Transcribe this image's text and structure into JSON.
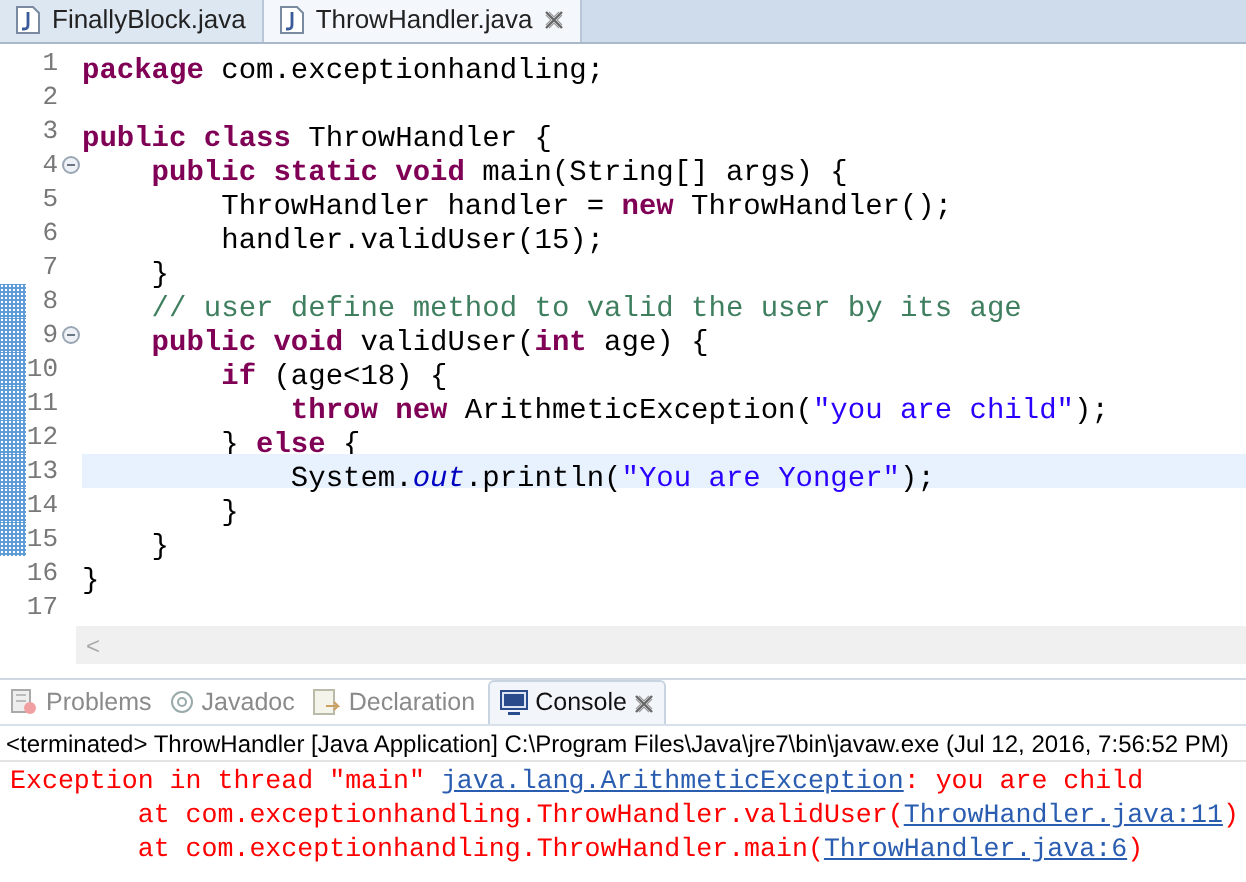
{
  "editor_tabs": [
    {
      "label": "FinallyBlock.java",
      "selected": false,
      "closable": false
    },
    {
      "label": "ThrowHandler.java",
      "selected": true,
      "closable": true
    }
  ],
  "editor": {
    "lines": [
      {
        "number": "1",
        "fold": false,
        "changed": false,
        "current": false,
        "tokens": [
          {
            "kind": "keyword",
            "text": "package"
          },
          {
            "kind": "plain",
            "text": " com.exceptionhandling;"
          }
        ]
      },
      {
        "number": "2",
        "fold": false,
        "changed": false,
        "current": false
      },
      {
        "number": "3",
        "fold": false,
        "changed": false,
        "current": false,
        "tokens": [
          {
            "kind": "keyword",
            "text": "public class"
          },
          {
            "kind": "plain",
            "text": " ThrowHandler {"
          }
        ]
      },
      {
        "number": "4",
        "fold": true,
        "changed": false,
        "current": false,
        "tokens": [
          {
            "kind": "keyword",
            "text": "    public static void"
          },
          {
            "kind": "plain",
            "text": " main(String[] args) {"
          }
        ]
      },
      {
        "number": "5",
        "fold": false,
        "changed": false,
        "current": false,
        "tokens": [
          {
            "kind": "plain",
            "text": "        ThrowHandler handler = "
          },
          {
            "kind": "keyword",
            "text": "new"
          },
          {
            "kind": "plain",
            "text": " ThrowHandler();"
          }
        ]
      },
      {
        "number": "6",
        "fold": false,
        "changed": false,
        "current": false,
        "tokens": [
          {
            "kind": "plain",
            "text": "        handler.validUser(15);"
          }
        ]
      },
      {
        "number": "7",
        "fold": false,
        "changed": false,
        "current": false,
        "tokens": [
          {
            "kind": "plain",
            "text": "    }"
          }
        ]
      },
      {
        "number": "8",
        "fold": false,
        "changed": true,
        "current": false,
        "tokens": [
          {
            "kind": "comment",
            "text": "    // user define method to valid the user by its age"
          }
        ]
      },
      {
        "number": "9",
        "fold": true,
        "changed": true,
        "current": false,
        "tokens": [
          {
            "kind": "keyword",
            "text": "    public void"
          },
          {
            "kind": "plain",
            "text": " validUser("
          },
          {
            "kind": "keyword",
            "text": "int"
          },
          {
            "kind": "plain",
            "text": " age) {"
          }
        ]
      },
      {
        "number": "10",
        "fold": false,
        "changed": true,
        "current": false,
        "tokens": [
          {
            "kind": "keyword",
            "text": "        if"
          },
          {
            "kind": "plain",
            "text": " (age<18) {"
          }
        ]
      },
      {
        "number": "11",
        "fold": false,
        "changed": true,
        "current": false,
        "tokens": [
          {
            "kind": "keyword",
            "text": "            throw new"
          },
          {
            "kind": "plain",
            "text": " ArithmeticException("
          },
          {
            "kind": "string",
            "text": "\"you are child\""
          },
          {
            "kind": "plain",
            "text": ");"
          }
        ]
      },
      {
        "number": "12",
        "fold": false,
        "changed": true,
        "current": false,
        "tokens": [
          {
            "kind": "plain",
            "text": "        } "
          },
          {
            "kind": "keyword",
            "text": "else"
          },
          {
            "kind": "plain",
            "text": " {"
          }
        ]
      },
      {
        "number": "13",
        "fold": false,
        "changed": true,
        "current": true,
        "tokens": [
          {
            "kind": "plain",
            "text": "            System."
          },
          {
            "kind": "field",
            "text": "out"
          },
          {
            "kind": "plain",
            "text": ".println("
          },
          {
            "kind": "string",
            "text": "\"You are Yonger\""
          },
          {
            "kind": "plain",
            "text": ");"
          }
        ]
      },
      {
        "number": "14",
        "fold": false,
        "changed": true,
        "current": false,
        "tokens": [
          {
            "kind": "plain",
            "text": "        }"
          }
        ]
      },
      {
        "number": "15",
        "fold": false,
        "changed": true,
        "current": false,
        "tokens": [
          {
            "kind": "plain",
            "text": "    }"
          }
        ]
      },
      {
        "number": "16",
        "fold": false,
        "changed": false,
        "current": false,
        "tokens": [
          {
            "kind": "plain",
            "text": "}"
          }
        ]
      },
      {
        "number": "17",
        "fold": false,
        "changed": false,
        "current": false
      }
    ],
    "scroll_arrow": "<"
  },
  "panel_tabs": [
    {
      "label": "Problems",
      "kind": "problems",
      "selected": false
    },
    {
      "label": "Javadoc",
      "kind": "javadoc",
      "selected": false
    },
    {
      "label": "Declaration",
      "kind": "declaration",
      "selected": false
    },
    {
      "label": "Console",
      "kind": "console",
      "selected": true
    }
  ],
  "console": {
    "header": "<terminated> ThrowHandler [Java Application] C:\\Program Files\\Java\\jre7\\bin\\javaw.exe (Jul 12, 2016, 7:56:52 PM)",
    "lines": [
      [
        {
          "kind": "error",
          "text": "Exception in thread \"main\" "
        },
        {
          "kind": "link",
          "text": "java.lang.ArithmeticException"
        },
        {
          "kind": "error",
          "text": ": you are child"
        }
      ],
      [
        {
          "kind": "error",
          "text": "        at com.exceptionhandling.ThrowHandler.validUser("
        },
        {
          "kind": "link",
          "text": "ThrowHandler.java:11"
        },
        {
          "kind": "error",
          "text": ")"
        }
      ],
      [
        {
          "kind": "error",
          "text": "        at com.exceptionhandling.ThrowHandler.main("
        },
        {
          "kind": "link",
          "text": "ThrowHandler.java:6"
        },
        {
          "kind": "error",
          "text": ")"
        }
      ]
    ]
  }
}
